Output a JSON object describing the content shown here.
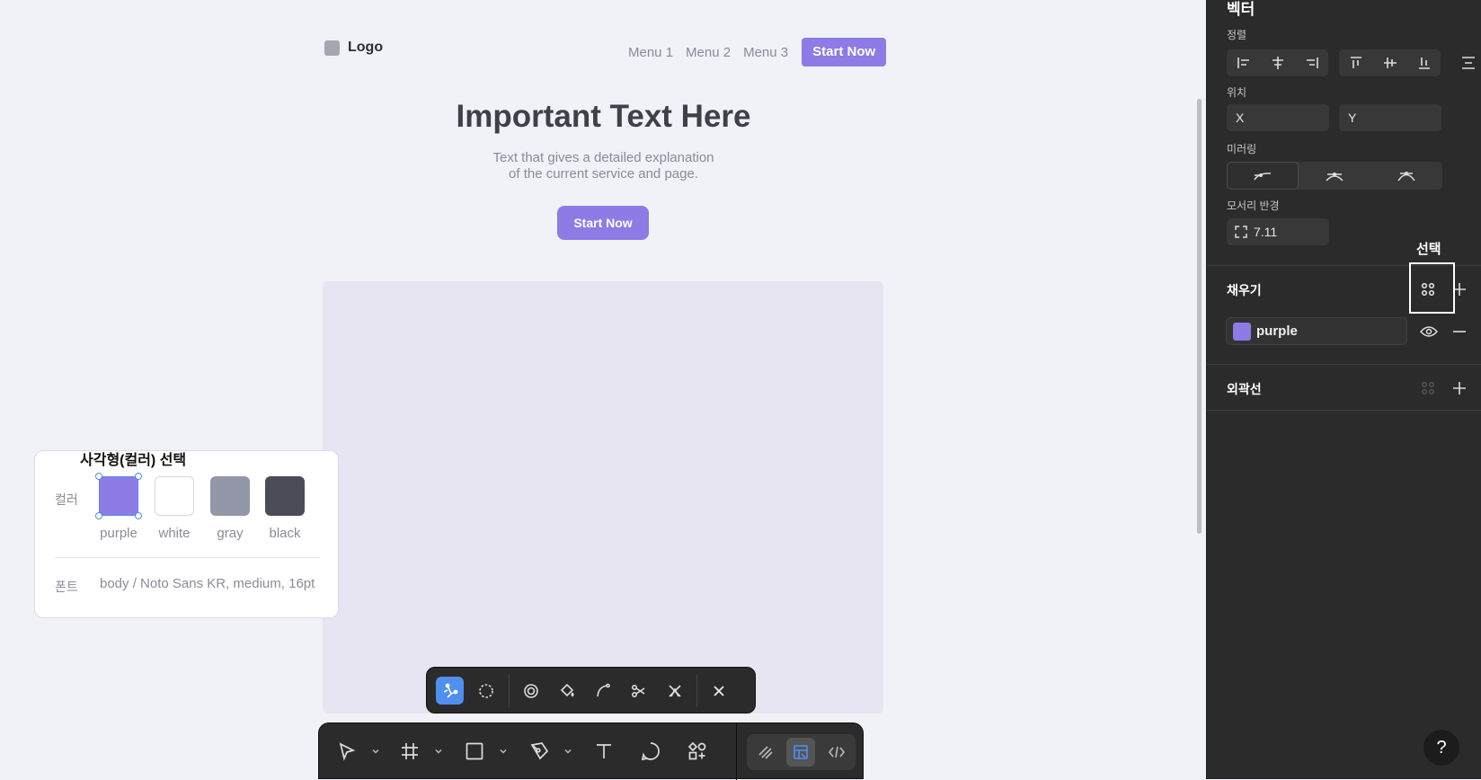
{
  "page": {
    "logo_text": "Logo",
    "nav": [
      "Menu 1",
      "Menu 2",
      "Menu 3"
    ],
    "nav_cta": "Start Now",
    "hero_title": "Important Text Here",
    "hero_sub_line1": "Text that gives a detailed explanation",
    "hero_sub_line2": "of the current service and page.",
    "hero_cta": "Start Now"
  },
  "annotation": {
    "title": "사각형(컬러) 선택",
    "color_label": "컬러",
    "font_label": "폰트",
    "swatches": [
      {
        "name": "purple",
        "color": "#8e7be6",
        "selected": true
      },
      {
        "name": "white",
        "color": "#ffffff"
      },
      {
        "name": "gray",
        "color": "#9497a8"
      },
      {
        "name": "black",
        "color": "#4a4c58"
      }
    ],
    "font_value": "body / Noto Sans KR, medium, 16pt"
  },
  "vector_toolbar": {
    "tools": [
      "node-edit",
      "lasso",
      "boolean",
      "paint-bucket",
      "curve",
      "cut",
      "delete-node"
    ],
    "active": "node-edit"
  },
  "main_toolbar": {
    "tools": [
      "move",
      "frame",
      "rectangle",
      "pen",
      "text",
      "comment",
      "components"
    ],
    "group": [
      "draw",
      "dev-mode",
      "code"
    ],
    "active_group": "dev-mode"
  },
  "panel": {
    "heading": "벡터",
    "align_label": "정렬",
    "position_label": "위치",
    "x_placeholder": "X",
    "y_placeholder": "Y",
    "mirroring_label": "미러링",
    "corner_radius_label": "모서리 반경",
    "corner_radius_value": "7.11",
    "select_note": "선택",
    "fill_label": "채우기",
    "fill_name": "purple",
    "fill_color": "#8e7be6",
    "stroke_label": "외곽선",
    "help_label": "?"
  }
}
